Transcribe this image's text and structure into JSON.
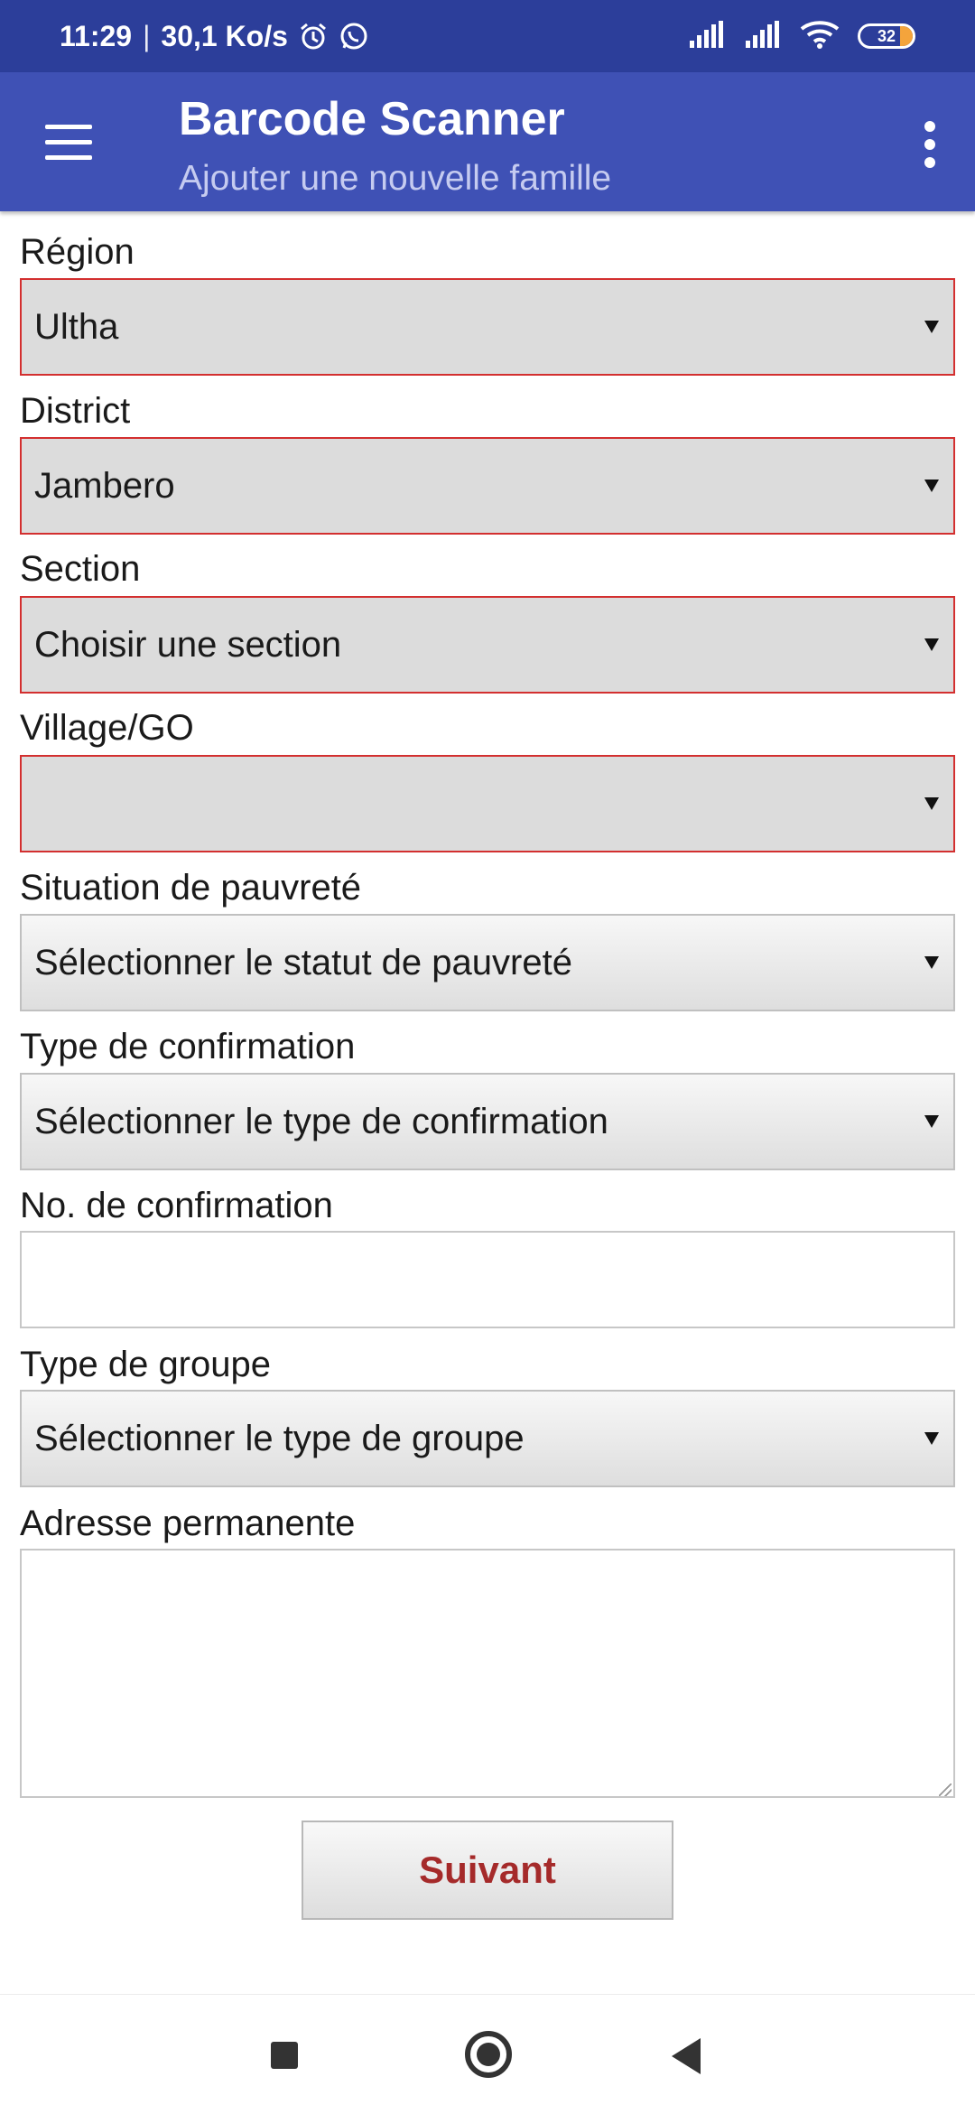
{
  "status_bar": {
    "time": "11:29",
    "separator": "|",
    "speed": "30,1 Ko/s",
    "battery_level": "32",
    "icons": [
      "alarm-icon",
      "whatsapp-icon",
      "signal-icon",
      "signal-icon",
      "wifi-icon",
      "battery-icon"
    ]
  },
  "app_bar": {
    "title": "Barcode Scanner",
    "subtitle": "Ajouter une nouvelle famille",
    "menu_icon": "hamburger-menu-icon",
    "overflow_icon": "more-vert-icon",
    "background": "#3f51b5",
    "status_background": "#2c3e9a"
  },
  "form": {
    "region": {
      "label": "Région",
      "value": "Ultha"
    },
    "district": {
      "label": "District",
      "value": "Jambero"
    },
    "section": {
      "label": "Section",
      "value": "Choisir une section"
    },
    "village": {
      "label": "Village/GO",
      "value": ""
    },
    "poverty": {
      "label": "Situation de pauvreté",
      "value": "Sélectionner le statut de pauvreté"
    },
    "confirmation_type": {
      "label": "Type de confirmation",
      "value": "Sélectionner le type de confirmation"
    },
    "confirmation_no": {
      "label": "No. de confirmation",
      "value": ""
    },
    "group_type": {
      "label": "Type de groupe",
      "value": "Sélectionner le type de groupe"
    },
    "address": {
      "label": "Adresse permanente",
      "value": ""
    },
    "submit_label": "Suivant",
    "error_border_color": "#d32f2f",
    "submit_text_color": "#a52a2a"
  },
  "nav_bar": {
    "icons": [
      "recents-square-icon",
      "home-circle-icon",
      "back-triangle-icon"
    ]
  }
}
